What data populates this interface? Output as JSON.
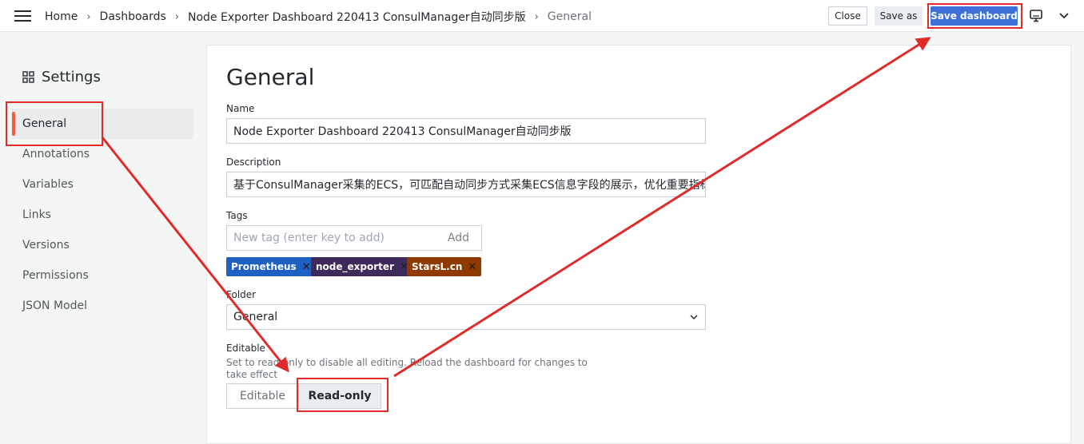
{
  "topbar": {
    "breadcrumb": [
      "Home",
      "Dashboards",
      "Node Exporter Dashboard 220413 ConsulManager自动同步版",
      "General"
    ],
    "separator": "›",
    "close_label": "Close",
    "save_as_label": "Save as",
    "save_dashboard_label": "Save dashboard"
  },
  "sidebar": {
    "title": "Settings",
    "items": [
      {
        "label": "General",
        "active": true
      },
      {
        "label": "Annotations"
      },
      {
        "label": "Variables"
      },
      {
        "label": "Links"
      },
      {
        "label": "Versions"
      },
      {
        "label": "Permissions"
      },
      {
        "label": "JSON Model"
      }
    ]
  },
  "main": {
    "title": "General",
    "name_label": "Name",
    "name_value": "Node Exporter Dashboard 220413 ConsulManager自动同步版",
    "description_label": "Description",
    "description_value": "基于ConsulManager采集的ECS，可匹配自动同步方式采集ECS信息字段的展示，优化重要指标",
    "tags_label": "Tags",
    "tag_placeholder": "New tag (enter key to add)",
    "tag_add_label": "Add",
    "tags": [
      {
        "name": "Prometheus",
        "color": "#1f60c4"
      },
      {
        "name": "node_exporter",
        "color": "#3f2b5b"
      },
      {
        "name": "StarsL.cn",
        "color": "#8f3b00"
      }
    ],
    "folder_label": "Folder",
    "folder_value": "General",
    "editable_label": "Editable",
    "editable_help": "Set to read-only to disable all editing. Reload the dashboard for changes to take effect",
    "editable_options": [
      "Editable",
      "Read-only"
    ],
    "editable_selected": "Read-only"
  },
  "colors": {
    "primary": "#3d71d9",
    "active_indicator": "#f55f3e",
    "annotation": "#e02b2b"
  },
  "icons": [
    "hamburger-menu-icon",
    "settings-grid-icon",
    "tv-mode-icon",
    "chevron-down-icon",
    "remove-tag-icon"
  ]
}
